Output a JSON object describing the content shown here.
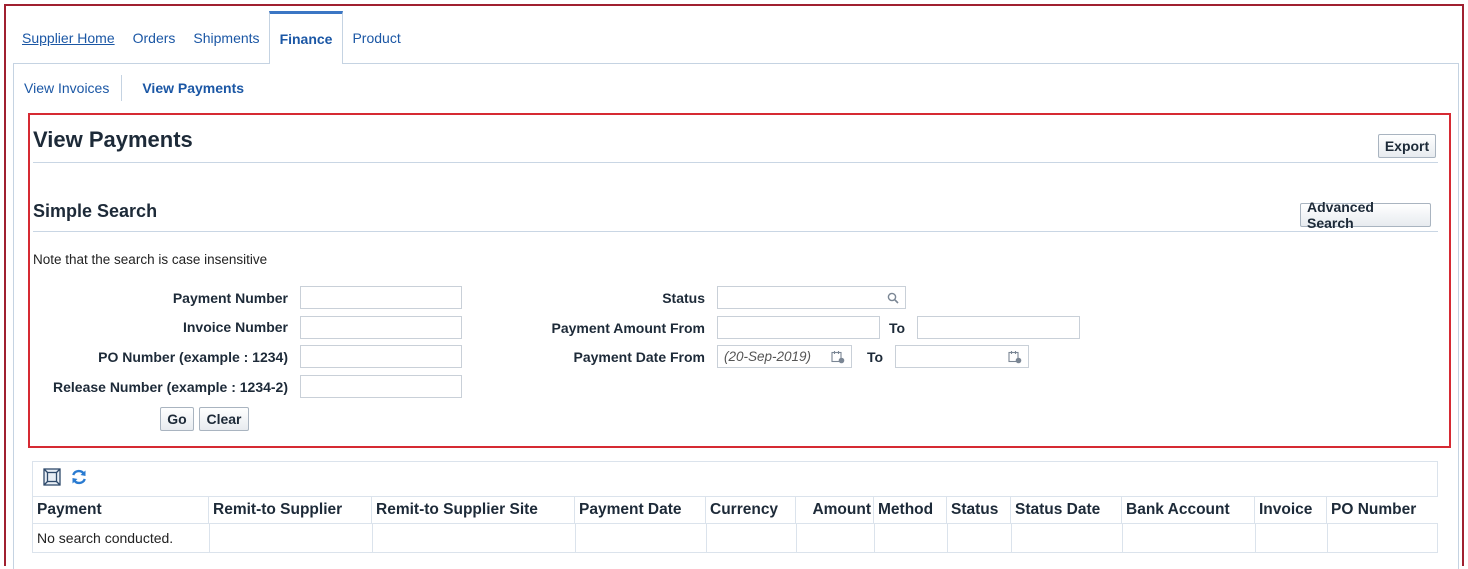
{
  "tabs": {
    "supplier_home": "Supplier Home",
    "orders": "Orders",
    "shipments": "Shipments",
    "finance": "Finance",
    "product": "Product"
  },
  "subtabs": {
    "view_invoices": "View Invoices",
    "view_payments": "View Payments"
  },
  "page": {
    "title": "View Payments",
    "export_label": "Export"
  },
  "search": {
    "title": "Simple Search",
    "advanced_label": "Advanced Search",
    "note": "Note that the search is case insensitive",
    "payment_number_label": "Payment Number",
    "invoice_number_label": "Invoice Number",
    "po_number_label": "PO Number (example : 1234)",
    "release_number_label": "Release Number (example : 1234-2)",
    "status_label": "Status",
    "amount_from_label": "Payment Amount From",
    "amount_to_label": "To",
    "date_from_label": "Payment Date From",
    "date_to_label": "To",
    "date_from_placeholder": "(20-Sep-2019)",
    "go_label": "Go",
    "clear_label": "Clear"
  },
  "results": {
    "columns": [
      "Payment",
      "Remit-to Supplier",
      "Remit-to Supplier Site",
      "Payment Date",
      "Currency",
      "Amount",
      "Method",
      "Status",
      "Status Date",
      "Bank Account",
      "Invoice",
      "PO Number"
    ],
    "empty_message": "No search conducted."
  },
  "colors": {
    "link": "#1b57a5",
    "highlight_border": "#d62a33",
    "header_text": "#1d2a38",
    "frame_border": "#a02030"
  },
  "icons": {
    "status_lookup": "search-icon",
    "date_picker": "calendar-icon",
    "detach_table": "detach-icon",
    "refresh": "refresh-icon"
  }
}
